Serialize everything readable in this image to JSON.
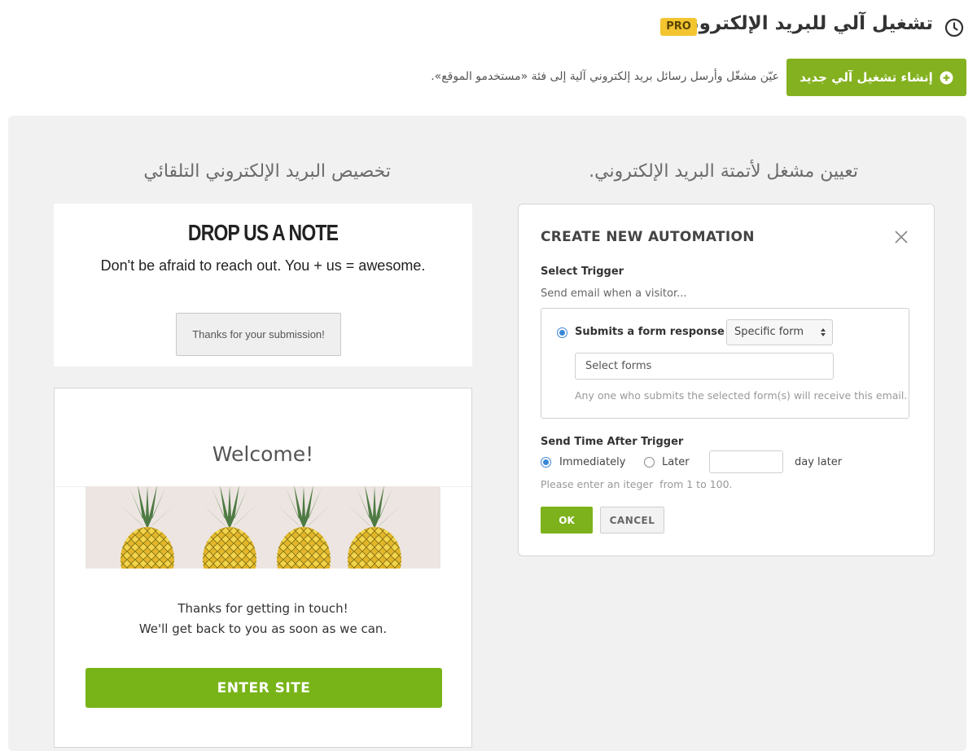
{
  "header": {
    "title": "تشغيل آلي للبريد الإلكتروني",
    "pro_badge": "PRO",
    "create_button": "إنشاء تشغيل آلي جديد",
    "description": "عيّن مشغّل وأرسل رسائل بريد إلكتروني آلية إلى فئة «مستخدمو الموقع»."
  },
  "columns": {
    "left_heading": "تخصيص البريد الإلكتروني التلقائي",
    "right_heading": "تعيين مشغل لأتمتة البريد الإلكتروني."
  },
  "form_preview": {
    "title": "DROP US A NOTE",
    "subtitle": "Don't be afraid to reach out. You + us = awesome.",
    "thanks_message": "Thanks for your submission!"
  },
  "email_preview": {
    "heading": "Welcome!",
    "message_line1": "Thanks for getting in touch!",
    "message_line2": "We'll get back to you as soon as we can.",
    "button": "ENTER SITE"
  },
  "dialog": {
    "title": "CREATE NEW AUTOMATION",
    "select_trigger_label": "Select Trigger",
    "send_when_text": "Send email when a visitor...",
    "trigger_option": "Submits a form response to",
    "form_scope": {
      "selected": "Specific form"
    },
    "forms_input_placeholder": "Select forms",
    "trigger_help": "Any one who submits the selected form(s) will receive this email.",
    "send_time_label": "Send Time After Trigger",
    "immediately_label": "Immediately",
    "later_label": "Later",
    "day_later_label": "day later",
    "later_days_value": "",
    "range_help": "Please enter an iteger  from 1 to 100.",
    "ok_button": "OK",
    "cancel_button": "CANCEL"
  },
  "colors": {
    "accent_green": "#84b120",
    "pro_badge": "#f2c531",
    "radio_blue": "#3a86d6",
    "panel_bg": "#f1f1f1"
  }
}
